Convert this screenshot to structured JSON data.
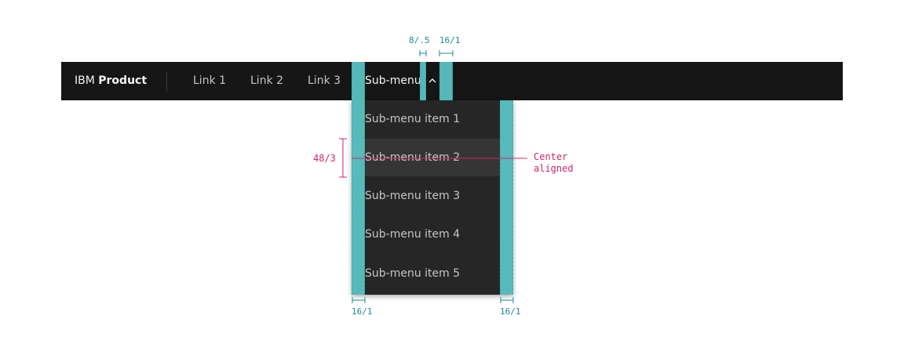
{
  "header": {
    "brand_prefix": "IBM",
    "brand_name": "Product",
    "links": [
      "Link 1",
      "Link 2",
      "Link 3"
    ],
    "submenu_label": "Sub-menu"
  },
  "menu": {
    "items": [
      "Sub-menu item 1",
      "Sub-menu item 2",
      "Sub-menu item 3",
      "Sub-menu item 4",
      "Sub-menu item 5"
    ],
    "active_index": 1
  },
  "annotations": {
    "icon_gap": "8/.5",
    "trigger_right_padding": "16/1",
    "item_height": "48/3",
    "center_note_line1": "Center",
    "center_note_line2": "aligned",
    "menu_left_padding": "16/1",
    "menu_right_padding": "16/1"
  },
  "colors": {
    "header_bg": "#161616",
    "menu_bg": "#262626",
    "menu_active_bg": "#353535",
    "spacing_overlay": "#5bc5c7",
    "annotation_teal": "#1c8a93",
    "annotation_pink": "#d02670"
  }
}
